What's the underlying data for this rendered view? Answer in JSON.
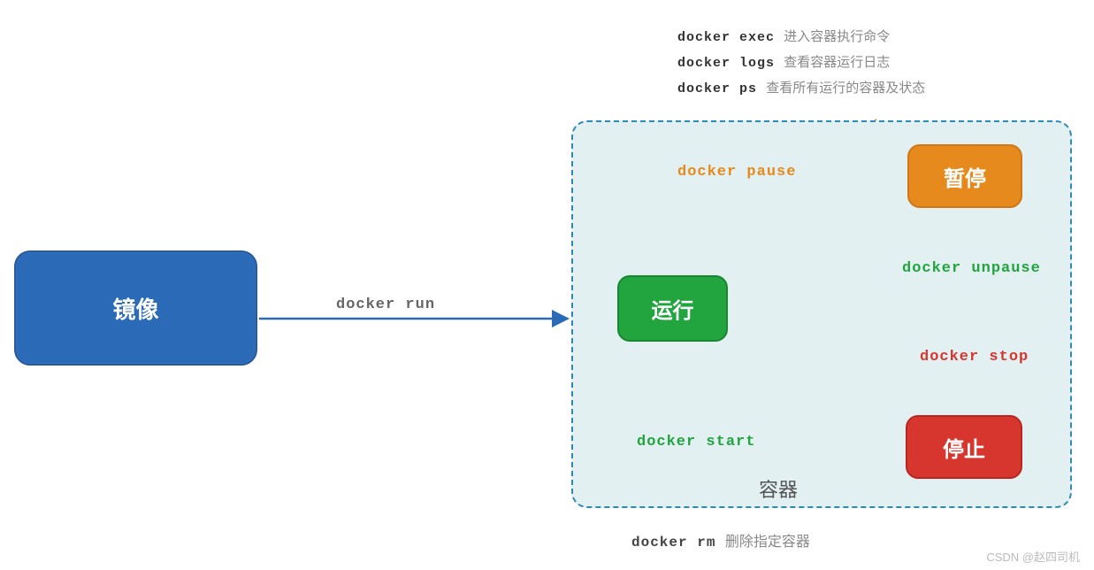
{
  "commands_top": [
    {
      "cmd": "docker exec",
      "desc": "进入容器执行命令"
    },
    {
      "cmd": "docker logs",
      "desc": "查看容器运行日志"
    },
    {
      "cmd": "docker ps",
      "desc": "查看所有运行的容器及状态"
    }
  ],
  "image_box": "镜像",
  "run_arrow_label": "docker run",
  "container_title": "容器",
  "states": {
    "run": "运行",
    "pause": "暂停",
    "stop": "停止"
  },
  "transitions": {
    "pause": "docker pause",
    "unpause": "docker unpause",
    "stop": "docker stop",
    "start": "docker start"
  },
  "rm_command": {
    "cmd": "docker rm",
    "desc": "删除指定容器"
  },
  "watermark": "CSDN @赵四司机",
  "colors": {
    "blue": "#2a6ab6",
    "green": "#22a43f",
    "orange": "#e68a1d",
    "red": "#d6362e",
    "teal_bg": "#e2f0f2",
    "teal_border": "#2c8ab3"
  }
}
